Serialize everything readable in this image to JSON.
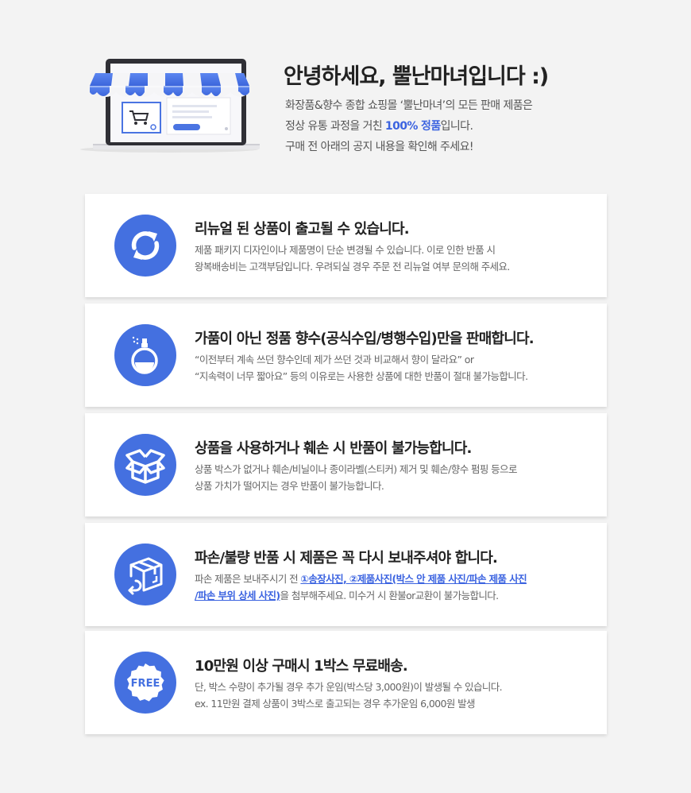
{
  "header": {
    "title": "안녕하세요, 뿔난마녀입니다 :)",
    "lines": [
      "화장품&향수 종합 쇼핑몰 ‘뿔난마녀’의 모든 판매 제품은",
      "구매 전 아래의 공지 내용을 확인해 주세요!"
    ],
    "line2_prefix": "정상 유통 과정을 거친 ",
    "line2_accent": "100% 정품",
    "line2_suffix": "입니다."
  },
  "notices": [
    {
      "icon": "refresh-icon",
      "title": "리뉴얼 된 상품이 출고될 수 있습니다.",
      "lines": [
        "제품 패키지 디자인이나 제품명이 단순 변경될 수 있습니다. 이로 인한 반품 시",
        "왕복배송비는 고객부담입니다. 우려되실 경우 주문 전 리뉴얼 여부 문의해 주세요."
      ]
    },
    {
      "icon": "perfume-icon",
      "title": "가품이 아닌 정품 향수(공식수입/병행수입)만을 판매합니다.",
      "lines": [
        "“이전부터 계속 쓰던 향수인데 제가 쓰던 것과 비교해서 향이 달라요” or",
        "“지속력이 너무 짧아요” 등의 이유로는 사용한 상품에 대한 반품이 절대 불가능합니다."
      ]
    },
    {
      "icon": "open-box-icon",
      "title": "상품을 사용하거나 훼손 시 반품이 불가능합니다.",
      "lines": [
        "상품 박스가 없거나 훼손/비닐이나 종이라벨(스티커) 제거 및 훼손/향수 펌핑 등으로",
        "상품 가치가 떨어지는 경우 반품이 불가능합니다."
      ]
    },
    {
      "icon": "return-box-icon",
      "title": "파손/불량 반품 시 제품은 꼭 다시 보내주셔야 합니다.",
      "line1_prefix": "파손 제품은 보내주시기 전 ",
      "line1_highlight": "①송장사진, ②제품사진(박스 안 제품 사진/파손 제품 사진",
      "line2_highlight": "/파손 부위 상세 사진)",
      "line2_suffix": "을 첨부해주세요. 미수거 시 환불or교환이 불가능합니다."
    },
    {
      "icon": "free-badge-icon",
      "icon_text": "FREE",
      "title": "10만원 이상 구매시 1박스 무료배송.",
      "lines": [
        "단, 박스 수량이 추가될 경우 추가 운임(박스당 3,000원)이 발생될 수 있습니다.",
        "ex. 11만원 결제 상품이 3박스로 출고되는 경우 추가운임 6,000원 발생"
      ]
    }
  ],
  "colors": {
    "accent": "#3b63e0",
    "icon_bg": "#4470e0",
    "background": "#f3f3f3"
  }
}
